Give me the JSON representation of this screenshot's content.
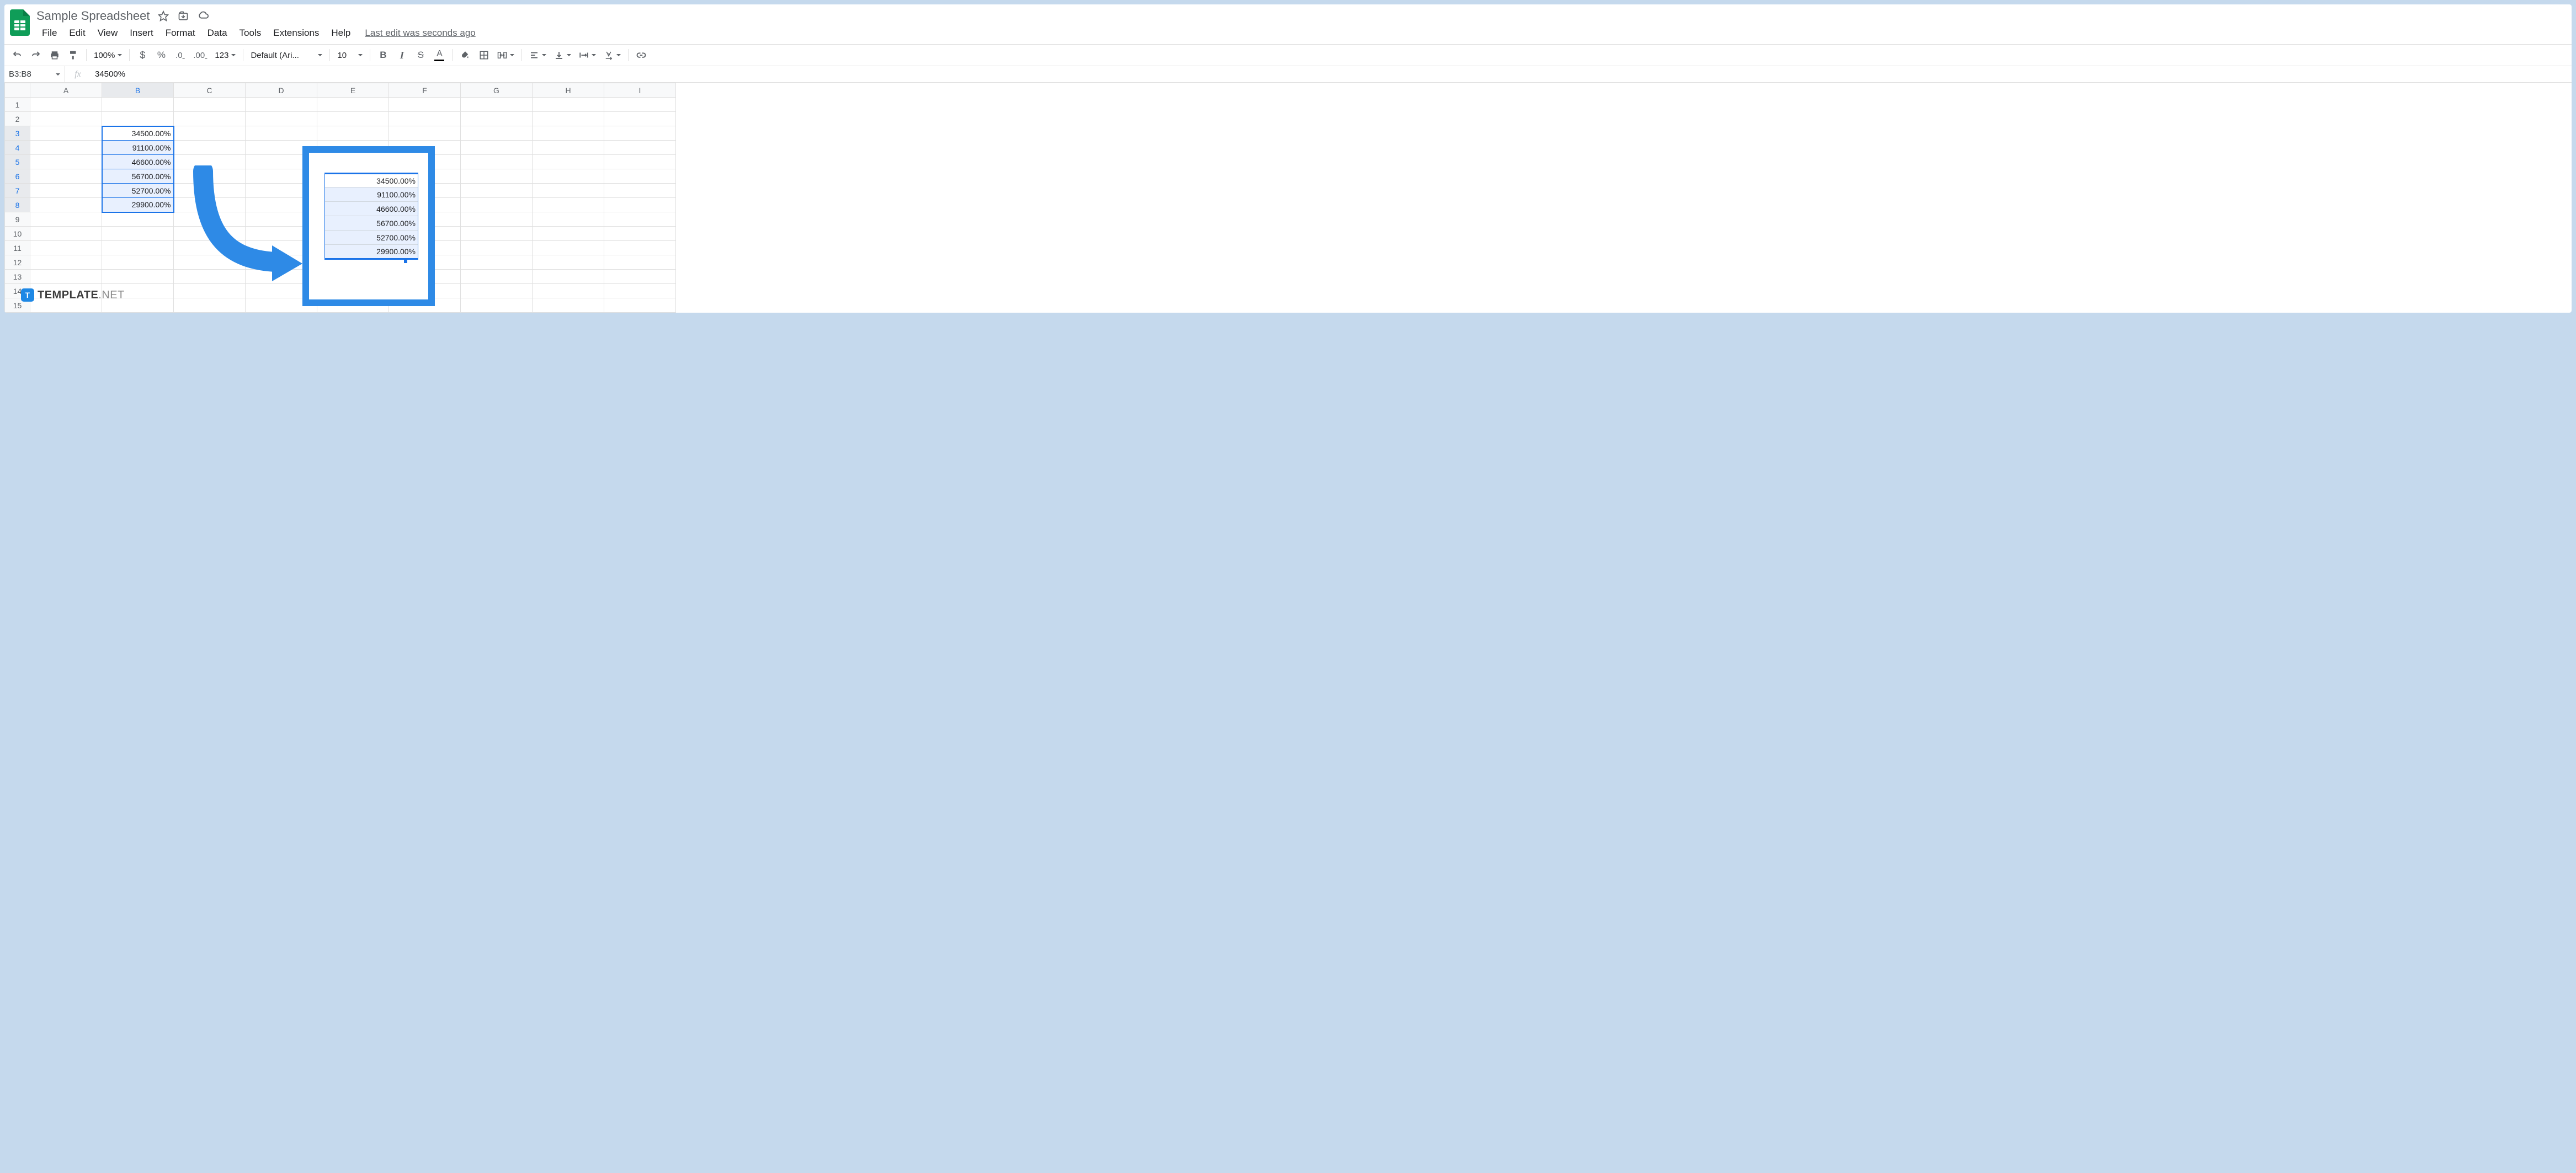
{
  "doc": {
    "title": "Sample Spreadsheet",
    "last_edit": "Last edit was seconds ago"
  },
  "menu": [
    "File",
    "Edit",
    "View",
    "Insert",
    "Format",
    "Data",
    "Tools",
    "Extensions",
    "Help"
  ],
  "toolbar": {
    "zoom": "100%",
    "font": "Default (Ari...",
    "font_size": "10",
    "more_formats": "123"
  },
  "formula_bar": {
    "name_box": "B3:B8",
    "fx": "fx",
    "value": "34500%"
  },
  "columns": [
    "A",
    "B",
    "C",
    "D",
    "E",
    "F",
    "G",
    "H",
    "I"
  ],
  "rows": [
    "1",
    "2",
    "3",
    "4",
    "5",
    "6",
    "7",
    "8",
    "9",
    "10",
    "11",
    "12",
    "13",
    "14",
    "15"
  ],
  "cells": {
    "B3": "34500.00%",
    "B4": "91100.00%",
    "B5": "46600.00%",
    "B6": "56700.00%",
    "B7": "52700.00%",
    "B8": "29900.00%"
  },
  "callout_cells": [
    "34500.00%",
    "91100.00%",
    "46600.00%",
    "56700.00%",
    "52700.00%",
    "29900.00%"
  ],
  "watermark": {
    "brand": "TEMPLATE",
    "suffix": ".NET"
  }
}
